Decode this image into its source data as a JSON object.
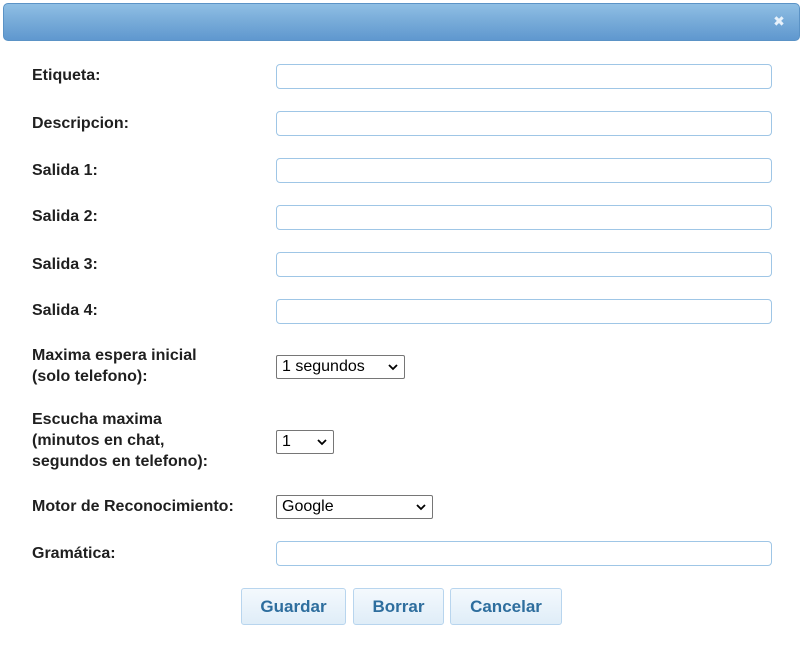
{
  "dialog": {
    "close_icon": "close-icon"
  },
  "form": {
    "etiqueta": {
      "label": "Etiqueta:",
      "value": ""
    },
    "descripcion": {
      "label": "Descripcion:",
      "value": ""
    },
    "salida1": {
      "label": "Salida 1:",
      "value": ""
    },
    "salida2": {
      "label": "Salida 2:",
      "value": ""
    },
    "salida3": {
      "label": "Salida 3:",
      "value": ""
    },
    "salida4": {
      "label": "Salida 4:",
      "value": ""
    },
    "maxima_espera": {
      "label": "Maxima espera inicial\n(solo telefono):",
      "selected": "1 segundos"
    },
    "escucha_maxima": {
      "label": "Escucha maxima\n(minutos en chat,\nsegundos en telefono):",
      "selected": "1"
    },
    "motor": {
      "label": "Motor de Reconocimiento:",
      "selected": "Google"
    },
    "gramatica": {
      "label": "Gramática:",
      "value": ""
    }
  },
  "buttons": {
    "guardar": "Guardar",
    "borrar": "Borrar",
    "cancelar": "Cancelar"
  },
  "colors": {
    "titlebar": "#79acd9",
    "input_border": "#9fc6e6",
    "button_text": "#2e6e9e"
  }
}
